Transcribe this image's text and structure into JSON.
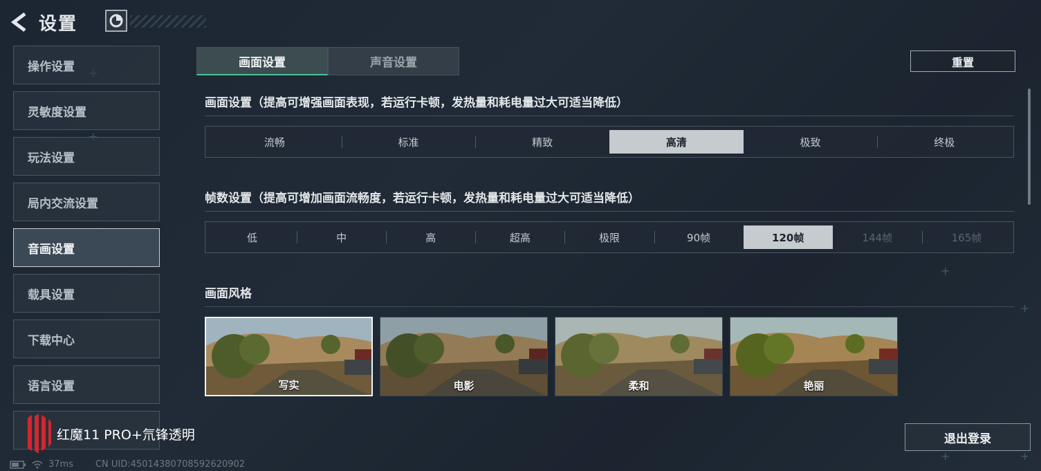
{
  "header": {
    "title": "设置"
  },
  "sidebar": {
    "items": [
      {
        "label": "操作设置"
      },
      {
        "label": "灵敏度设置"
      },
      {
        "label": "玩法设置"
      },
      {
        "label": "局内交流设置"
      },
      {
        "label": "音画设置",
        "active": true
      },
      {
        "label": "载具设置"
      },
      {
        "label": "下载中心"
      },
      {
        "label": "语言设置"
      }
    ]
  },
  "tabs": [
    {
      "label": "画面设置",
      "active": true
    },
    {
      "label": "声音设置"
    }
  ],
  "reset_label": "重置",
  "graphics": {
    "title": "画面设置（提高可增强画面表现，若运行卡顿，发热量和耗电量过大可适当降低）",
    "options": [
      "流畅",
      "标准",
      "精致",
      "高清",
      "极致",
      "终极"
    ],
    "selected": "高清"
  },
  "framerate": {
    "title": "帧数设置（提高可增加画面流畅度，若运行卡顿，发热量和耗电量过大可适当降低）",
    "options": [
      "低",
      "中",
      "高",
      "超高",
      "极限",
      "90帧",
      "120帧",
      "144帧",
      "165帧"
    ],
    "selected": "120帧",
    "disabled": [
      "144帧",
      "165帧"
    ]
  },
  "style": {
    "title": "画面风格",
    "options": [
      {
        "label": "写实",
        "selected": true
      },
      {
        "label": "电影"
      },
      {
        "label": "柔和"
      },
      {
        "label": "艳丽"
      }
    ]
  },
  "logout_label": "退出登录",
  "watermark": "红魔11 PRO+氘锋透明",
  "status": {
    "ping": "37ms",
    "uid": "CN UID:4501438070859262090​2"
  },
  "colors": {
    "accent": "#4ec49a",
    "selected_bg": "#c6cbcf"
  }
}
